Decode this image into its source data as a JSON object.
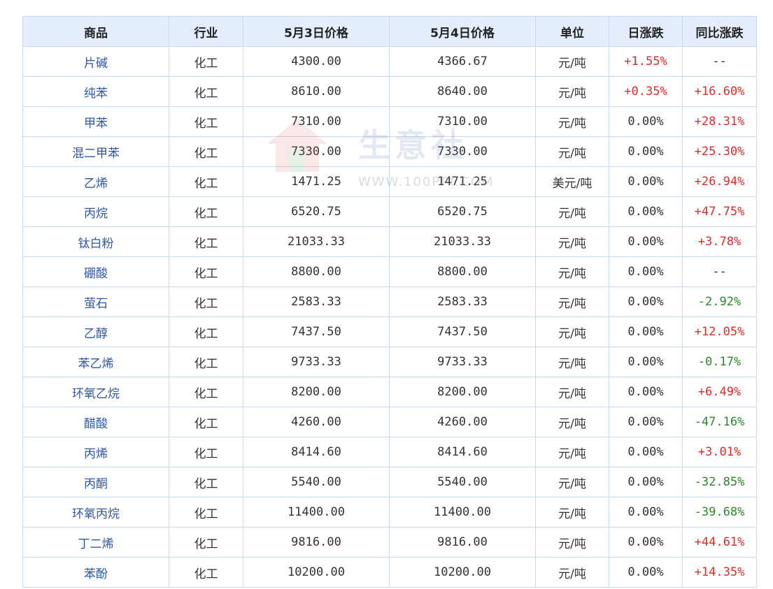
{
  "table": {
    "headers": [
      "商品",
      "行业",
      "5月3日价格",
      "5月4日价格",
      "单位",
      "日涨跌",
      "同比涨跌"
    ],
    "rows": [
      {
        "name": "片碱",
        "industry": "化工",
        "p1": "4300.00",
        "p2": "4366.67",
        "unit": "元/吨",
        "day": "+1.55%",
        "yoy": "--"
      },
      {
        "name": "纯苯",
        "industry": "化工",
        "p1": "8610.00",
        "p2": "8640.00",
        "unit": "元/吨",
        "day": "+0.35%",
        "yoy": "+16.60%"
      },
      {
        "name": "甲苯",
        "industry": "化工",
        "p1": "7310.00",
        "p2": "7310.00",
        "unit": "元/吨",
        "day": "0.00%",
        "yoy": "+28.31%"
      },
      {
        "name": "混二甲苯",
        "industry": "化工",
        "p1": "7330.00",
        "p2": "7330.00",
        "unit": "元/吨",
        "day": "0.00%",
        "yoy": "+25.30%"
      },
      {
        "name": "乙烯",
        "industry": "化工",
        "p1": "1471.25",
        "p2": "1471.25",
        "unit": "美元/吨",
        "day": "0.00%",
        "yoy": "+26.94%"
      },
      {
        "name": "丙烷",
        "industry": "化工",
        "p1": "6520.75",
        "p2": "6520.75",
        "unit": "元/吨",
        "day": "0.00%",
        "yoy": "+47.75%"
      },
      {
        "name": "钛白粉",
        "industry": "化工",
        "p1": "21033.33",
        "p2": "21033.33",
        "unit": "元/吨",
        "day": "0.00%",
        "yoy": "+3.78%"
      },
      {
        "name": "硼酸",
        "industry": "化工",
        "p1": "8800.00",
        "p2": "8800.00",
        "unit": "元/吨",
        "day": "0.00%",
        "yoy": "--"
      },
      {
        "name": "萤石",
        "industry": "化工",
        "p1": "2583.33",
        "p2": "2583.33",
        "unit": "元/吨",
        "day": "0.00%",
        "yoy": "-2.92%"
      },
      {
        "name": "乙醇",
        "industry": "化工",
        "p1": "7437.50",
        "p2": "7437.50",
        "unit": "元/吨",
        "day": "0.00%",
        "yoy": "+12.05%"
      },
      {
        "name": "苯乙烯",
        "industry": "化工",
        "p1": "9733.33",
        "p2": "9733.33",
        "unit": "元/吨",
        "day": "0.00%",
        "yoy": "-0.17%"
      },
      {
        "name": "环氧乙烷",
        "industry": "化工",
        "p1": "8200.00",
        "p2": "8200.00",
        "unit": "元/吨",
        "day": "0.00%",
        "yoy": "+6.49%"
      },
      {
        "name": "醋酸",
        "industry": "化工",
        "p1": "4260.00",
        "p2": "4260.00",
        "unit": "元/吨",
        "day": "0.00%",
        "yoy": "-47.16%"
      },
      {
        "name": "丙烯",
        "industry": "化工",
        "p1": "8414.60",
        "p2": "8414.60",
        "unit": "元/吨",
        "day": "0.00%",
        "yoy": "+3.01%"
      },
      {
        "name": "丙酮",
        "industry": "化工",
        "p1": "5540.00",
        "p2": "5540.00",
        "unit": "元/吨",
        "day": "0.00%",
        "yoy": "-32.85%"
      },
      {
        "name": "环氧丙烷",
        "industry": "化工",
        "p1": "11400.00",
        "p2": "11400.00",
        "unit": "元/吨",
        "day": "0.00%",
        "yoy": "-39.68%"
      },
      {
        "name": "丁二烯",
        "industry": "化工",
        "p1": "9816.00",
        "p2": "9816.00",
        "unit": "元/吨",
        "day": "0.00%",
        "yoy": "+44.61%"
      },
      {
        "name": "苯酚",
        "industry": "化工",
        "p1": "10200.00",
        "p2": "10200.00",
        "unit": "元/吨",
        "day": "0.00%",
        "yoy": "+14.35%"
      }
    ]
  },
  "watermark": {
    "brand": "生意社",
    "url": "WWW.100PPI.COM"
  },
  "colors": {
    "up": "#e02b2b",
    "down": "#2a8a2a",
    "header_bg": "#e3edfb",
    "name_link": "#2f56a6"
  }
}
